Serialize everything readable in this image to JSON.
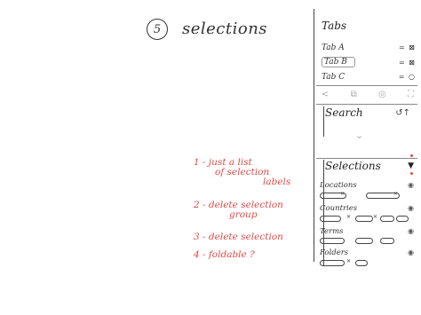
{
  "page": {
    "number": "5",
    "title": "selections"
  },
  "notes": [
    {
      "num": "1",
      "text": "- just a list",
      "line2": "of selection",
      "line3": "labels"
    },
    {
      "num": "2",
      "text": "- delete selection",
      "line2": "group"
    },
    {
      "num": "3",
      "text": "- delete selection"
    },
    {
      "num": "4",
      "text": "- foldable ?"
    }
  ],
  "tabs": {
    "title": "Tabs",
    "items": [
      {
        "label": "Tab A",
        "controls": "= ⊠",
        "selected": false
      },
      {
        "label": "Tab B",
        "controls": "= ⊠",
        "selected": true
      },
      {
        "label": "Tab C",
        "controls": "= ○",
        "selected": false
      }
    ],
    "toolbar": [
      "<",
      "⧉",
      "◎",
      "⛶"
    ]
  },
  "search": {
    "title": "Search",
    "icon": "refresh-icon",
    "collapse_glyph": "⌄"
  },
  "selections": {
    "title": "Selections",
    "groups": [
      {
        "label": "Locations"
      },
      {
        "label": "Countries"
      },
      {
        "label": "Terms"
      },
      {
        "label": "Folders"
      }
    ]
  },
  "colors": {
    "ink": "#333333",
    "annotation": "#e04848",
    "faded": "#aaaaaa"
  }
}
